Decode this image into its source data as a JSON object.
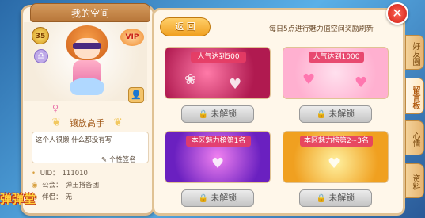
{
  "profile": {
    "panel_title": "我的空间",
    "level": "35",
    "vip_badge": "VIP",
    "title_text": "镶族高手",
    "signature": "这个人很懒 什么都没有写",
    "signature_button": "个性签名",
    "uid_label": "UID：",
    "uid_value": "111010",
    "guild_label": "公会：",
    "guild_value": "弹王搭备团",
    "partner_label": "伴侣：",
    "partner_value": "无"
  },
  "logo_text": "弹弹堂",
  "main": {
    "back_label": "返 回",
    "refresh_note": "每日5点进行魅力值空间奖励刷新",
    "cards": [
      {
        "label": "人气达到500",
        "button": "未解锁"
      },
      {
        "label": "人气达到1000",
        "button": "未解锁"
      },
      {
        "label": "本区魅力榜第1名",
        "button": "未解锁"
      },
      {
        "label": "本区魅力榜第2~3名",
        "button": "未解锁"
      }
    ]
  },
  "side_tabs": [
    {
      "label": "好友圈"
    },
    {
      "label": "留言板"
    },
    {
      "label": "心情"
    },
    {
      "label": "资料"
    }
  ],
  "close_label": "✕",
  "colors": {
    "accent": "#f0a020",
    "panel_bg": "#fff7ea",
    "close_red": "#d01a10"
  }
}
